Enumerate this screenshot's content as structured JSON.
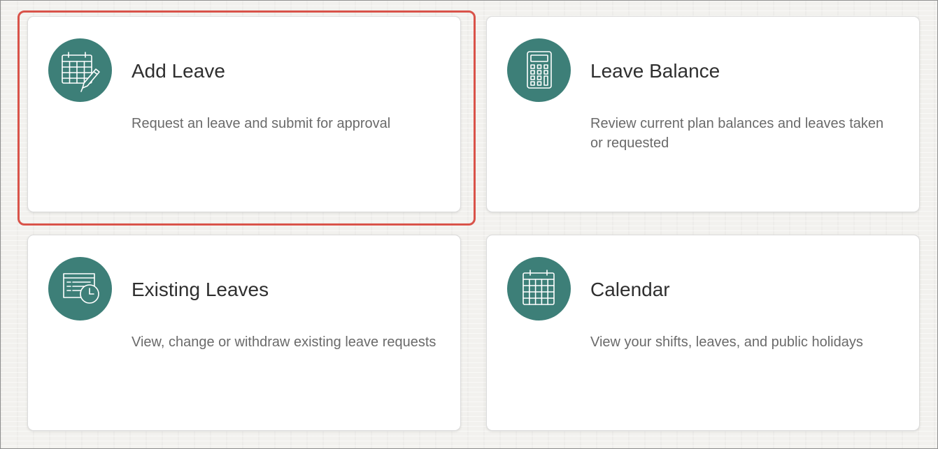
{
  "colors": {
    "icon_background": "#3d7f78",
    "selection_outline": "#d9534a",
    "card_background": "#ffffff",
    "page_background": "#f2f1ee"
  },
  "tiles": [
    {
      "title": "Add Leave",
      "description": "Request an leave and submit for approval",
      "icon": "calendar-edit-icon",
      "selected": true
    },
    {
      "title": "Leave Balance",
      "description": "Review current plan balances and leaves taken or requested",
      "icon": "calculator-icon",
      "selected": false
    },
    {
      "title": "Existing Leaves",
      "description": "View, change or withdraw existing leave requests",
      "icon": "document-clock-icon",
      "selected": false
    },
    {
      "title": "Calendar",
      "description": "View your shifts, leaves, and public holidays",
      "icon": "calendar-icon",
      "selected": false
    }
  ]
}
